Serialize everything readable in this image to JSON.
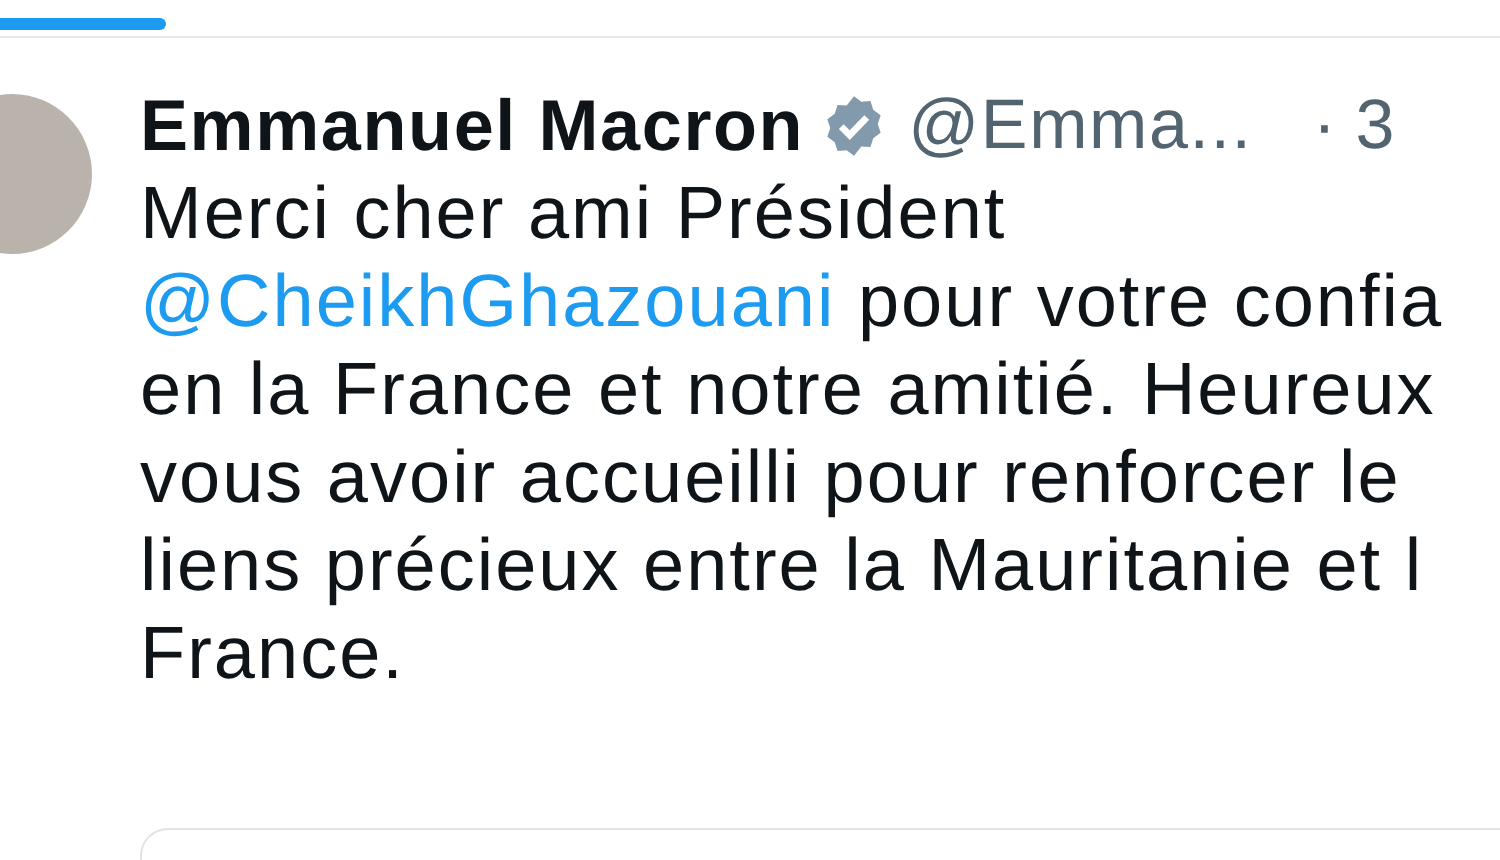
{
  "progress": {
    "level": 0.11
  },
  "tweet": {
    "author": "Emmanuel Macron",
    "verified": true,
    "handle": "@Emma...",
    "time": "· 3",
    "lines": [
      {
        "text": "Merci cher ami Président"
      },
      {
        "mention": "@CheikhGhazouani",
        "text": " pour votre confia"
      },
      {
        "text": "en la France et notre amitié. Heureux"
      },
      {
        "text": "vous avoir accueilli pour renforcer le"
      },
      {
        "text": "liens précieux entre la Mauritanie et l"
      },
      {
        "text": "France."
      }
    ]
  }
}
